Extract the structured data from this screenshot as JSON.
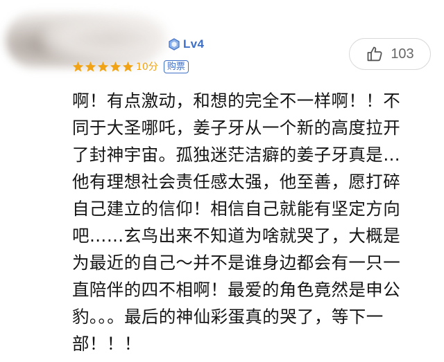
{
  "user": {
    "level": "Lv4"
  },
  "rating": {
    "stars": 5,
    "max_stars": 5,
    "score_label": "10分",
    "purchase_tag": "购票",
    "star_color": "#f1a313"
  },
  "like": {
    "count": "103",
    "icon": "thumbs-up-icon"
  },
  "comment": {
    "lines": [
      "啊！有点激动，和想的完全不一样啊！！不",
      "同于大圣哪吒，姜子牙从一个新的高度拉开",
      "了封神宇宙。孤独迷茫洁癖的姜子牙真是…",
      "他有理想社会责任感太强，他至善，愿打碎",
      "自己建立的信仰！相信自己就能有坚定方向",
      "吧……玄鸟出来不知道为啥就哭了，大概是",
      "为最近的自己～并不是谁身边都会有一只一",
      "直陪伴的四不相啊！最爱的角色竟然是申公",
      "豹。。。最后的神仙彩蛋真的哭了，等下一",
      "部！！！"
    ]
  },
  "colors": {
    "accent_blue": "#3e6fc6",
    "text": "#141414",
    "muted": "#666666"
  }
}
